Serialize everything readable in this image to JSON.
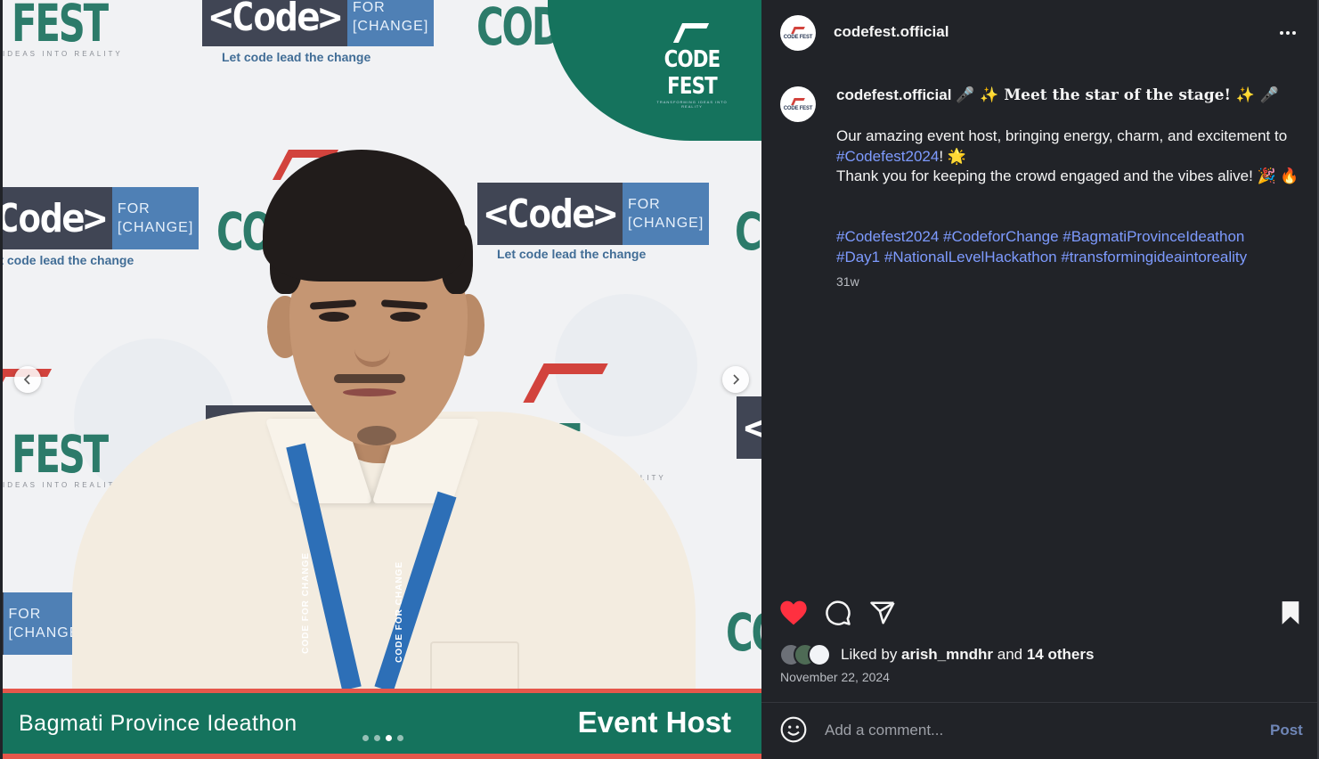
{
  "post_image": {
    "caption_left": "Bagmati Province Ideathon",
    "caption_right": "Event Host",
    "slides": {
      "count": 4,
      "active": 3
    },
    "backdrop": {
      "code": "<Code>",
      "for": "FOR",
      "change": "[CHANGE]",
      "tagline": "Let code lead the change",
      "brand": "CODE FEST",
      "brand_tag": "IDEAS INTO REALITY"
    },
    "lanyard": "CODE FOR CHANGE",
    "corner_logo": {
      "name": "CODE FEST",
      "tagline": "TRANSFORMING IDEAS INTO REALITY"
    }
  },
  "header": {
    "username": "codefest.official",
    "avatar_text": "CODE FEST",
    "more_icon": "more-horizontal-icon"
  },
  "caption": {
    "username": "codefest.official",
    "headline": "🎤 ✨ Meet the star of the stage! ✨ 🎤",
    "line1_pre": "Our amazing event host, bringing energy, charm, and excitement to ",
    "line1_tag": "#Codefest2024",
    "line1_post": "! 🌟",
    "line2": "Thank you for keeping the crowd engaged and the vibes alive! 🎉 🔥",
    "hashtags_line1": "#Codefest2024 #CodeforChange #BagmatiProvinceIdeathon",
    "hashtags_line2": "#Day1 #NationalLevelHackathon #transformingideaintoreality",
    "age": "31w"
  },
  "actions": {
    "like_icon": "heart-filled-icon",
    "comment_icon": "comment-icon",
    "share_icon": "send-icon",
    "save_icon": "bookmark-filled-icon",
    "liked_color": "#ff3040"
  },
  "likes": {
    "prefix": "Liked by ",
    "user": "arish_mndhr",
    "middle": " and ",
    "others": "14 others"
  },
  "date": "November 22, 2024",
  "comment_box": {
    "placeholder": "Add a comment...",
    "post_label": "Post"
  },
  "colors": {
    "brand_green": "#15735d",
    "brand_red": "#e6574b",
    "link": "#7e9bff",
    "panel_bg": "#212328"
  }
}
